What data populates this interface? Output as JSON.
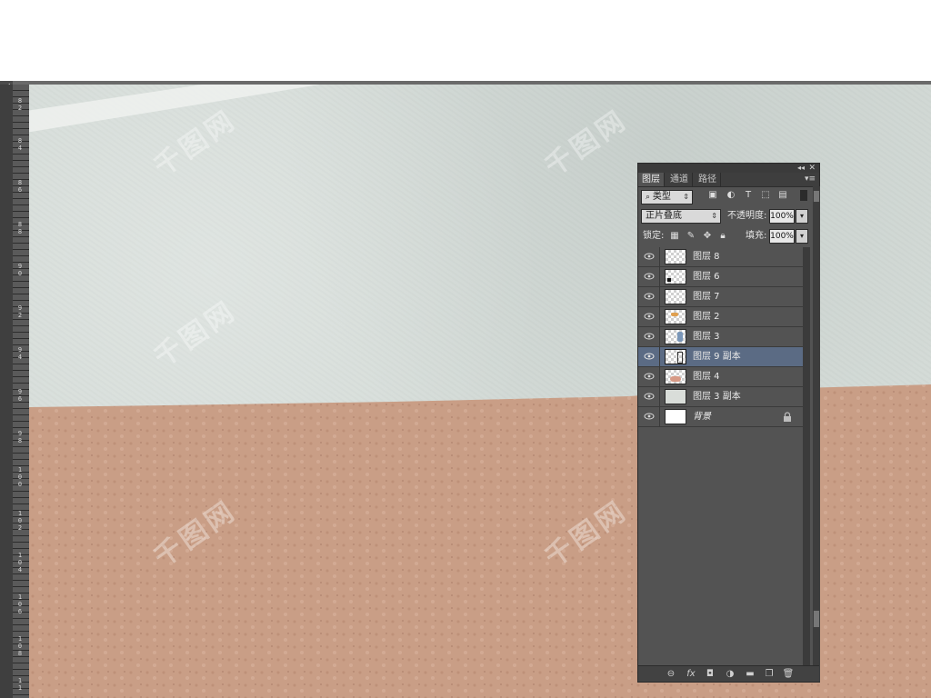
{
  "ruler": {
    "labels": [
      "8 2",
      "8 4",
      "8 6",
      "8 8",
      "9 0",
      "9 2",
      "9 4",
      "9 6",
      "9 8",
      "1 0 0",
      "1 0 2",
      "1 0 4",
      "1 0 6",
      "1 0 8",
      "1 1"
    ]
  },
  "watermark": {
    "text": "千图网"
  },
  "panel": {
    "tabs": [
      "图层",
      "通道",
      "路径"
    ],
    "active_tab": "图层",
    "filter": {
      "kind_label": "类型"
    },
    "blend_mode": "正片叠底",
    "opacity_label": "不透明度:",
    "opacity_value": "100%",
    "lock_label": "锁定:",
    "fill_label": "填充:",
    "fill_value": "100%",
    "layers": [
      {
        "name": "图层 8",
        "visible": true,
        "selected": false,
        "locked": false
      },
      {
        "name": "图层 6",
        "visible": true,
        "selected": false,
        "locked": false
      },
      {
        "name": "图层 7",
        "visible": true,
        "selected": false,
        "locked": false
      },
      {
        "name": "图层 2",
        "visible": true,
        "selected": false,
        "locked": false
      },
      {
        "name": "图层 3",
        "visible": true,
        "selected": false,
        "locked": false
      },
      {
        "name": "图层 9 副本",
        "visible": true,
        "selected": true,
        "locked": false
      },
      {
        "name": "图层 4",
        "visible": true,
        "selected": false,
        "locked": false
      },
      {
        "name": "图层 3 副本",
        "visible": true,
        "selected": false,
        "locked": false
      },
      {
        "name": "背景",
        "visible": true,
        "selected": false,
        "locked": true
      }
    ],
    "footer_icons": [
      "link-icon",
      "fx-icon",
      "mask-icon",
      "adjustment-icon",
      "folder-icon",
      "new-layer-icon",
      "trash-icon"
    ],
    "footer_fx_label": "fx"
  },
  "colors": {
    "canvas_sky": "#d5dcd8",
    "canvas_ground": "#c99e86",
    "selected_layer": "#5b6b84",
    "panel_bg": "#535353"
  }
}
